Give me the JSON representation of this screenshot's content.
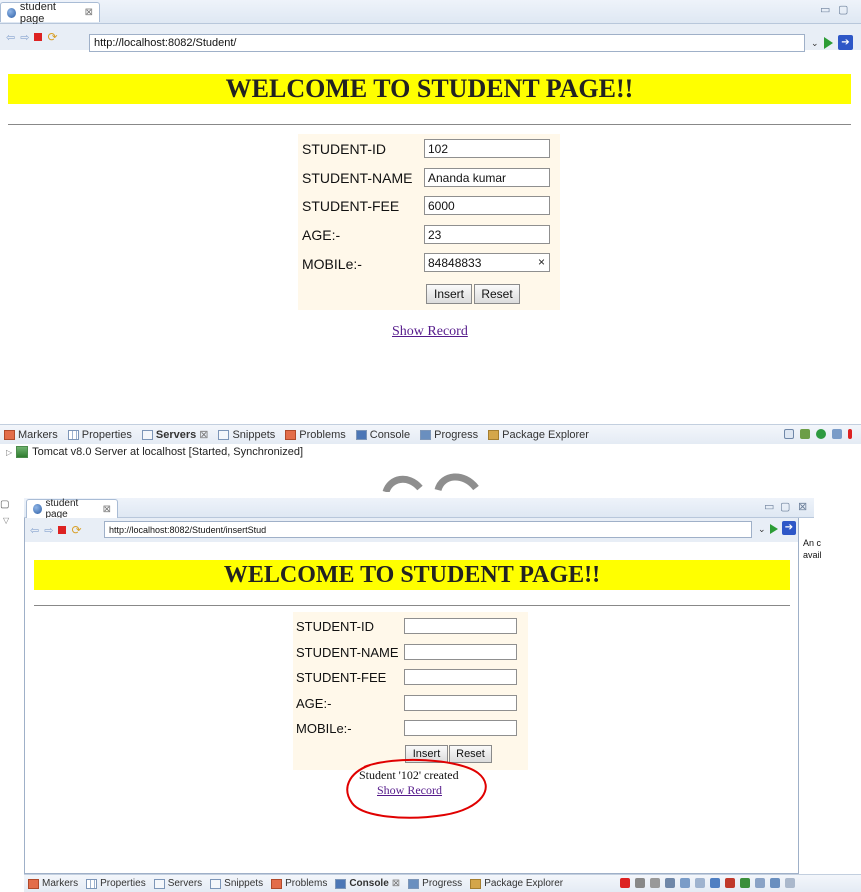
{
  "win1": {
    "tab_title": "student page",
    "url": "http://localhost:8082/Student/",
    "banner": "WELCOME TO STUDENT PAGE!!",
    "labels": {
      "id": "STUDENT-ID",
      "name": "STUDENT-NAME",
      "fee": "STUDENT-FEE",
      "age": "AGE:-",
      "mobile": "MOBILe:-"
    },
    "values": {
      "id": "102",
      "name": "Ananda kumar",
      "fee": "6000",
      "age": "23",
      "mobile": "84848833"
    },
    "clear_glyph": "×",
    "insert_label": "Insert",
    "reset_label": "Reset",
    "show_record": "Show Record"
  },
  "views1": {
    "tabs": [
      "Markers",
      "Properties",
      "Servers",
      "Snippets",
      "Problems",
      "Console",
      "Progress",
      "Package Explorer"
    ],
    "server_entry": "Tomcat v8.0 Server at localhost  [Started, Synchronized]"
  },
  "win2": {
    "tab_title": "student page",
    "url": "http://localhost:8082/Student/insertStud",
    "banner": "WELCOME TO STUDENT PAGE!!",
    "labels": {
      "id": "STUDENT-ID",
      "name": "STUDENT-NAME",
      "fee": "STUDENT-FEE",
      "age": "AGE:-",
      "mobile": "MOBILe:-"
    },
    "insert_label": "Insert",
    "reset_label": "Reset",
    "message": "Student '102' created",
    "show_record": "Show Record",
    "side_text": [
      "An c",
      "avail"
    ]
  },
  "views2": {
    "tabs": [
      "Markers",
      "Properties",
      "Servers",
      "Snippets",
      "Problems",
      "Console",
      "Progress",
      "Package Explorer"
    ]
  },
  "colors": {
    "banner": "#ffff00",
    "link": "#551a8b",
    "annotation": "#e00000",
    "form_bg": "#fff8ea"
  }
}
